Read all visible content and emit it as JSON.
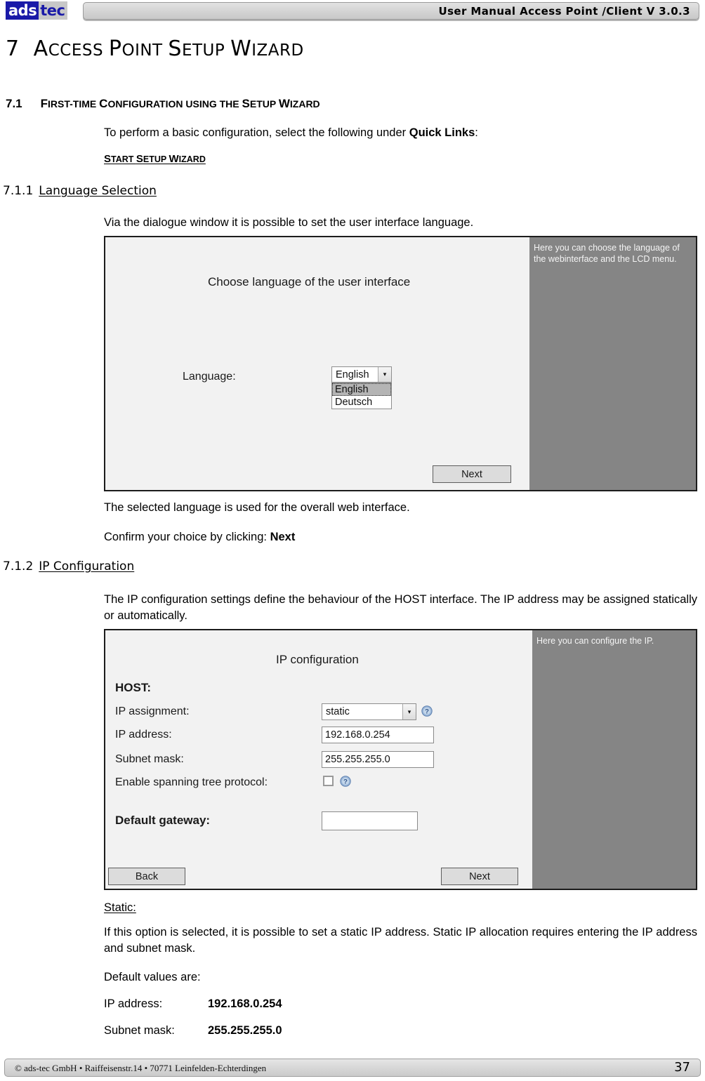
{
  "header": {
    "logo_part1": "ads",
    "logo_part2": "tec",
    "title": "User Manual Access  Point /Client V 3.0.3"
  },
  "chapter": {
    "number": "7",
    "title_first": "A",
    "title_rest": "CCESS ",
    "title_p": "P",
    "title_point": "OINT ",
    "title_s": "S",
    "title_setup": "ETUP ",
    "title_w": "W",
    "title_wizard": "IZARD",
    "full": "7  ACCESS POINT SETUP WIZARD"
  },
  "section_71": {
    "number": "7.1",
    "t1": "F",
    "t2": "IRST-TIME ",
    "t3": "C",
    "t4": "ONFIGURATION USING THE ",
    "t5": "S",
    "t6": "ETUP ",
    "t7": "W",
    "t8": "IZARD",
    "full": "7.1  FIRST-TIME CONFIGURATION USING THE SETUP WIZARD",
    "intro_before": "To perform a basic configuration, select the following under ",
    "intro_bold": "Quick Links",
    "intro_after": ":",
    "quick_link_s1": "S",
    "quick_link_t1": "TART ",
    "quick_link_s2": "S",
    "quick_link_t2": "ETUP ",
    "quick_link_w": "W",
    "quick_link_t3": "IZARD",
    "quick_link_full": "START SETUP WIZARD"
  },
  "section_711": {
    "number": "7.1.1",
    "title": "Language Selection",
    "paragraph": "Via the dialogue window it is possible to set the user interface language.",
    "after_1": "The selected language is used for the overall web interface.",
    "after_2_before": "Confirm your choice by clicking: ",
    "after_2_bold": "Next"
  },
  "language_dialog": {
    "heading": "Choose language of the user interface",
    "field_label": "Language:",
    "selected_value": "English",
    "options": [
      "English",
      "Deutsch"
    ],
    "next_button": "Next",
    "help_text": "Here you can choose the language of the webinterface and the LCD menu.",
    "dropdown_arrow": "▾"
  },
  "section_712": {
    "number": "7.1.2",
    "title": "IP Configuration",
    "paragraph": "The IP configuration settings define the behaviour of the HOST interface. The IP address may be assigned statically or automatically."
  },
  "ip_dialog": {
    "heading": "IP configuration",
    "host_label": "HOST:",
    "ip_assignment_label": "IP assignment:",
    "ip_assignment_value": "static",
    "ip_address_label": "IP address:",
    "ip_address_value": "192.168.0.254",
    "subnet_mask_label": "Subnet mask:",
    "subnet_mask_value": "255.255.255.0",
    "spanning_tree_label": "Enable spanning tree protocol:",
    "spanning_tree_checked": false,
    "default_gateway_label": "Default gateway:",
    "default_gateway_value": "",
    "back_button": "Back",
    "next_button": "Next",
    "help_text": "Here you can configure the IP.",
    "dropdown_arrow": "▾"
  },
  "static_section": {
    "heading": "Static:",
    "paragraph": "If this option is selected, it is possible to set a static IP address. Static IP allocation requires entering the IP address and subnet mask.",
    "defaults_intro": "Default values are:",
    "ip_label": "IP address:",
    "ip_value": "192.168.0.254",
    "subnet_label": "Subnet mask:",
    "subnet_value": "255.255.255.0"
  },
  "footer": {
    "copyright": "© ads-tec GmbH • Raiffeisenstr.14 • 70771 Leinfelden-Echterdingen",
    "page_number": "37"
  },
  "colors": {
    "logo_blue": "#1a1aa8",
    "side_panel_gray": "#858585",
    "dialog_bg": "#f2f2f2",
    "help_icon_blue": "#6b93c7"
  }
}
